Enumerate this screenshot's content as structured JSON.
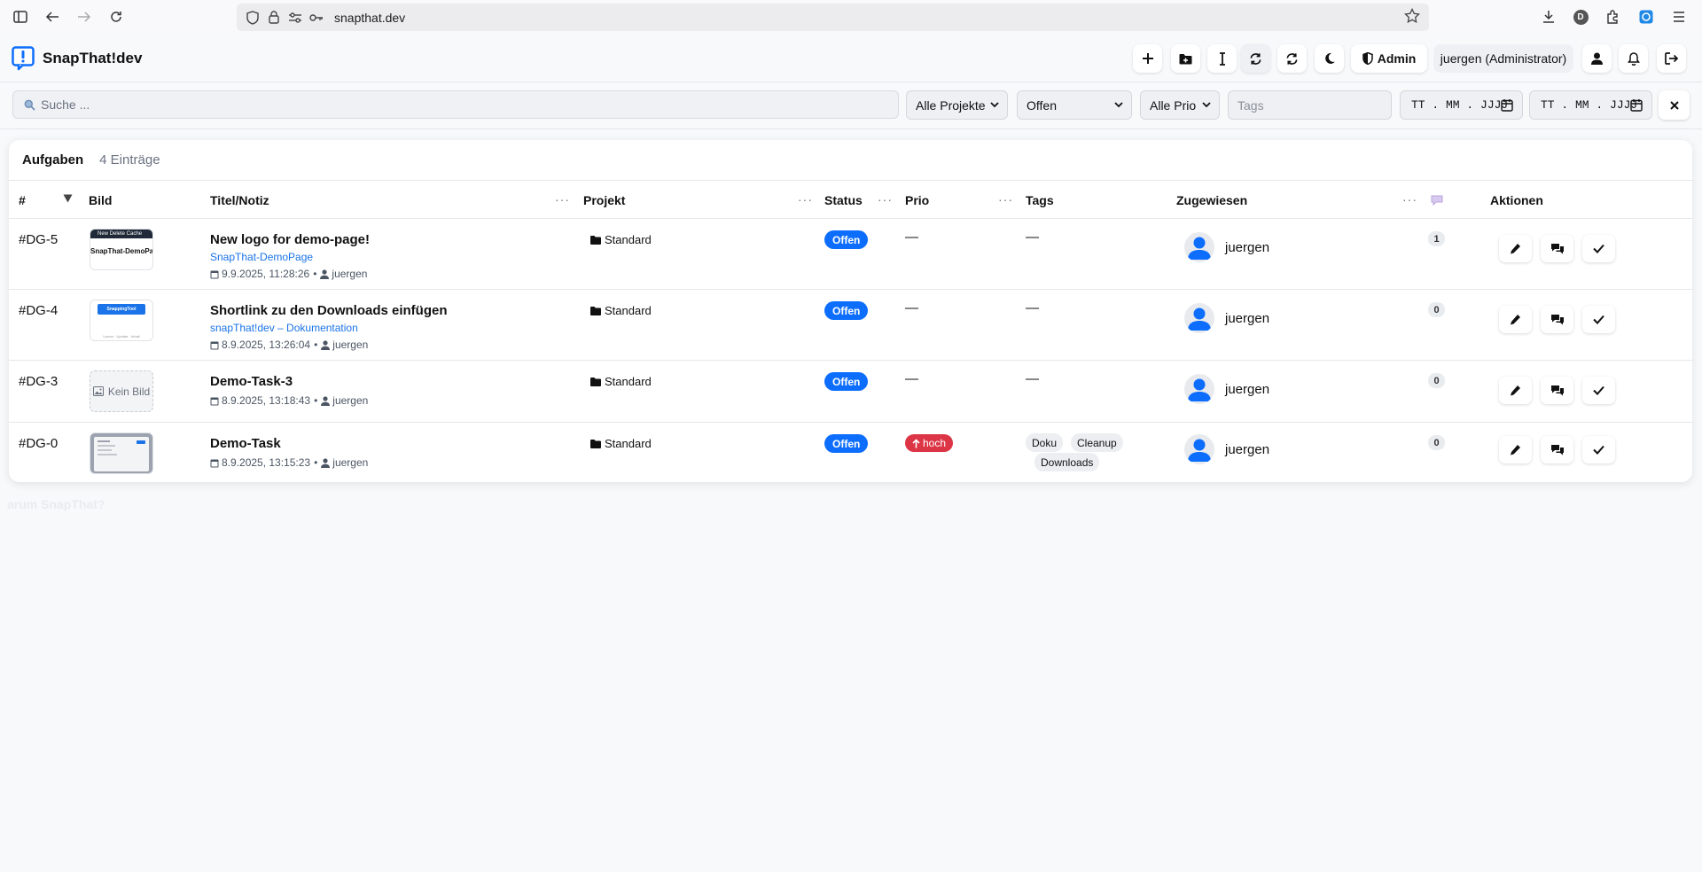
{
  "browser": {
    "url": "snapthat.dev",
    "profile_initial": "D"
  },
  "app": {
    "brand": "SnapThat!dev",
    "admin_label": "Admin",
    "user_label": "juergen (Administrator)"
  },
  "filters": {
    "search_placeholder": "Suche ...",
    "project": "Alle Projekte",
    "status": "Offen",
    "prio": "Alle Prio",
    "tags_placeholder": "Tags",
    "date_from": "TT . MM . JJJJ",
    "date_to": "TT . MM . JJJJ"
  },
  "table": {
    "title": "Aufgaben",
    "count": "4 Einträge",
    "columns": {
      "id": "#",
      "image": "Bild",
      "title": "Titel/Notiz",
      "project": "Projekt",
      "status": "Status",
      "prio": "Prio",
      "tags": "Tags",
      "assigned": "Zugewiesen",
      "actions": "Aktionen"
    },
    "rows": [
      {
        "id": "#DG-5",
        "title": "New logo for demo-page!",
        "sub": "SnapThat-DemoPage",
        "date": "9.9.2025, 11:28:26",
        "author": "juergen",
        "project": "Standard",
        "status": "Offen",
        "prio": "—",
        "tags_empty": "—",
        "assignee": "juergen",
        "comments": "1",
        "thumb_top": "New   Delete Cache",
        "thumb_text": "SnapThat-DemoPage"
      },
      {
        "id": "#DG-4",
        "title": "Shortlink zu den Downloads einfügen",
        "sub": "snapThat!dev – Dokumentation",
        "date": "8.9.2025, 13:26:04",
        "author": "juergen",
        "project": "Standard",
        "status": "Offen",
        "prio": "—",
        "tags_empty": "—",
        "assignee": "juergen",
        "comments": "0",
        "thumb_text": "SnappingTool",
        "thumb_line": "Lizenz · Update · Inhalt"
      },
      {
        "id": "#DG-3",
        "title": "Demo-Task-3",
        "date": "8.9.2025, 13:18:43",
        "author": "juergen",
        "project": "Standard",
        "status": "Offen",
        "prio": "—",
        "tags_empty": "—",
        "assignee": "juergen",
        "comments": "0",
        "thumb_empty": "Kein Bild"
      },
      {
        "id": "#DG-0",
        "title": "Demo-Task",
        "date": "8.9.2025, 13:15:23",
        "author": "juergen",
        "project": "Standard",
        "status": "Offen",
        "prio": "hoch",
        "tags": [
          "Doku",
          "Cleanup",
          "Downloads"
        ],
        "assignee": "juergen",
        "comments": "0"
      }
    ]
  },
  "ghost_text": "arum SnapThat?",
  "colors": {
    "accent": "#0d6efd",
    "danger": "#dc3545",
    "link": "#1a73e8"
  }
}
